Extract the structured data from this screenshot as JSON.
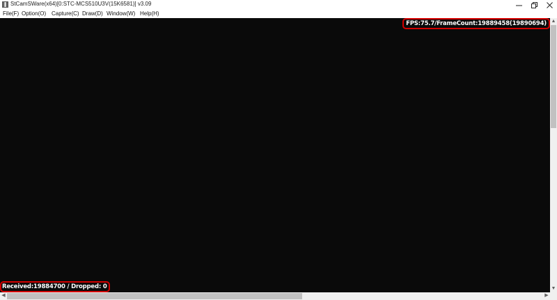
{
  "window": {
    "title": "StCamSWare(x64)[0:STC-MCS510U3V(15K6581)] v3.09",
    "controls": {
      "minimize_glyph": "—",
      "maximize_glyph": "❐",
      "close_glyph": "✕"
    }
  },
  "menu": {
    "items": [
      {
        "label": "File(F)"
      },
      {
        "label": "Option(O)"
      },
      {
        "label": "Capture(C)"
      },
      {
        "label": "Draw(D)"
      },
      {
        "label": "Window(W)"
      },
      {
        "label": "Help(H)"
      }
    ]
  },
  "viewport": {
    "background": "#0a0a0a",
    "overlay_fps": "FPS:75.7/FrameCount:19889458(19890694)",
    "overlay_stats": "Received:19884700 / Dropped: 0",
    "highlight_color": "#d40000"
  },
  "scrollbars": {
    "up_arrow": "▲",
    "down_arrow": "▼",
    "left_arrow": "◀",
    "right_arrow": "▶"
  }
}
